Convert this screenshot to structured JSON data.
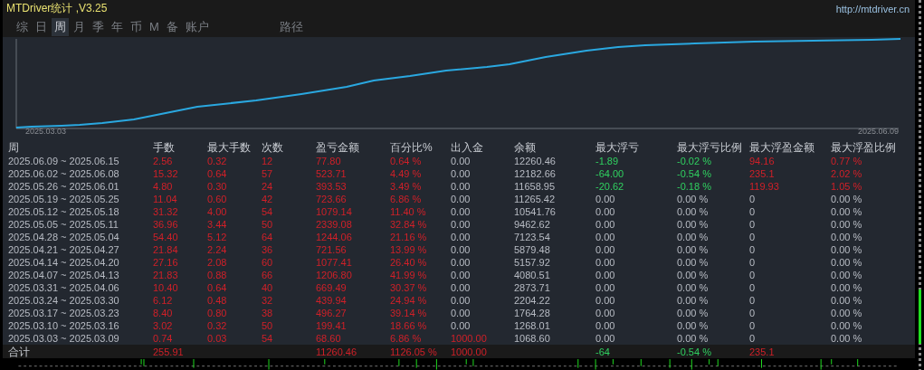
{
  "window": {
    "title": "MTDriver统计 ,V3.25",
    "link": "http://mtdriver.cn"
  },
  "tabs": [
    {
      "label": "综",
      "selected": false
    },
    {
      "label": "日",
      "selected": false
    },
    {
      "label": "周",
      "selected": true
    },
    {
      "label": "月",
      "selected": false
    },
    {
      "label": "季",
      "selected": false
    },
    {
      "label": "年",
      "selected": false
    },
    {
      "label": "币",
      "selected": false
    },
    {
      "label": "M",
      "selected": false
    },
    {
      "label": "备",
      "selected": false
    },
    {
      "label": "账户",
      "selected": false
    }
  ],
  "path_button": "路径",
  "chart": {
    "start_label": "2025.03.03",
    "end_label": "2025.06.09"
  },
  "table": {
    "columns": [
      "周",
      "手数",
      "最大手数",
      "次数",
      "盈亏金额",
      "百分比%",
      "出入金",
      "余额",
      "最大浮亏",
      "最大浮亏比例",
      "最大浮盈金额",
      "最大浮盈比例"
    ],
    "rows": [
      {
        "cells": [
          {
            "text": "2025.06.09 ~ 2025.06.15",
            "kind": "plain"
          },
          {
            "text": "2.56",
            "kind": "gain"
          },
          {
            "text": "0.32",
            "kind": "gain"
          },
          {
            "text": "12",
            "kind": "gain"
          },
          {
            "text": "77.80",
            "kind": "gain"
          },
          {
            "text": "0.64 %",
            "kind": "gain"
          },
          {
            "text": "0.00",
            "kind": "plain"
          },
          {
            "text": "12260.46",
            "kind": "plain"
          },
          {
            "text": "-1.89",
            "kind": "loss"
          },
          {
            "text": "-0.02 %",
            "kind": "loss"
          },
          {
            "text": "94.16",
            "kind": "gain"
          },
          {
            "text": "0.77 %",
            "kind": "gain"
          }
        ]
      },
      {
        "cells": [
          {
            "text": "2025.06.02 ~ 2025.06.08",
            "kind": "plain"
          },
          {
            "text": "15.32",
            "kind": "gain"
          },
          {
            "text": "0.64",
            "kind": "gain"
          },
          {
            "text": "57",
            "kind": "gain"
          },
          {
            "text": "523.71",
            "kind": "gain"
          },
          {
            "text": "4.49 %",
            "kind": "gain"
          },
          {
            "text": "0.00",
            "kind": "plain"
          },
          {
            "text": "12182.66",
            "kind": "plain"
          },
          {
            "text": "-64.00",
            "kind": "loss"
          },
          {
            "text": "-0.54 %",
            "kind": "loss"
          },
          {
            "text": "235.1",
            "kind": "gain"
          },
          {
            "text": "2.02 %",
            "kind": "gain"
          }
        ]
      },
      {
        "cells": [
          {
            "text": "2025.05.26 ~ 2025.06.01",
            "kind": "plain"
          },
          {
            "text": "4.80",
            "kind": "gain"
          },
          {
            "text": "0.30",
            "kind": "gain"
          },
          {
            "text": "24",
            "kind": "gain"
          },
          {
            "text": "393.53",
            "kind": "gain"
          },
          {
            "text": "3.49 %",
            "kind": "gain"
          },
          {
            "text": "0.00",
            "kind": "plain"
          },
          {
            "text": "11658.95",
            "kind": "plain"
          },
          {
            "text": "-20.62",
            "kind": "loss"
          },
          {
            "text": "-0.18 %",
            "kind": "loss"
          },
          {
            "text": "119.93",
            "kind": "gain"
          },
          {
            "text": "1.05 %",
            "kind": "gain"
          }
        ]
      },
      {
        "cells": [
          {
            "text": "2025.05.19 ~ 2025.05.25",
            "kind": "plain"
          },
          {
            "text": "11.04",
            "kind": "gain"
          },
          {
            "text": "0.60",
            "kind": "gain"
          },
          {
            "text": "42",
            "kind": "gain"
          },
          {
            "text": "723.66",
            "kind": "gain"
          },
          {
            "text": "6.86 %",
            "kind": "gain"
          },
          {
            "text": "0.00",
            "kind": "plain"
          },
          {
            "text": "11265.42",
            "kind": "plain"
          },
          {
            "text": "0.00",
            "kind": "plain"
          },
          {
            "text": "0.00 %",
            "kind": "plain"
          },
          {
            "text": "0",
            "kind": "plain"
          },
          {
            "text": "0.00 %",
            "kind": "plain"
          }
        ]
      },
      {
        "cells": [
          {
            "text": "2025.05.12 ~ 2025.05.18",
            "kind": "plain"
          },
          {
            "text": "31.32",
            "kind": "gain"
          },
          {
            "text": "4.00",
            "kind": "gain"
          },
          {
            "text": "54",
            "kind": "gain"
          },
          {
            "text": "1079.14",
            "kind": "gain"
          },
          {
            "text": "11.40 %",
            "kind": "gain"
          },
          {
            "text": "0.00",
            "kind": "plain"
          },
          {
            "text": "10541.76",
            "kind": "plain"
          },
          {
            "text": "0.00",
            "kind": "plain"
          },
          {
            "text": "0.00 %",
            "kind": "plain"
          },
          {
            "text": "0",
            "kind": "plain"
          },
          {
            "text": "0.00 %",
            "kind": "plain"
          }
        ]
      },
      {
        "cells": [
          {
            "text": "2025.05.05 ~ 2025.05.11",
            "kind": "plain"
          },
          {
            "text": "36.96",
            "kind": "gain"
          },
          {
            "text": "3.44",
            "kind": "gain"
          },
          {
            "text": "50",
            "kind": "gain"
          },
          {
            "text": "2339.08",
            "kind": "gain"
          },
          {
            "text": "32.84 %",
            "kind": "gain"
          },
          {
            "text": "0.00",
            "kind": "plain"
          },
          {
            "text": "9462.62",
            "kind": "plain"
          },
          {
            "text": "0.00",
            "kind": "plain"
          },
          {
            "text": "0.00 %",
            "kind": "plain"
          },
          {
            "text": "0",
            "kind": "plain"
          },
          {
            "text": "0.00 %",
            "kind": "plain"
          }
        ]
      },
      {
        "cells": [
          {
            "text": "2025.04.28 ~ 2025.05.04",
            "kind": "plain"
          },
          {
            "text": "54.40",
            "kind": "gain"
          },
          {
            "text": "5.12",
            "kind": "gain"
          },
          {
            "text": "64",
            "kind": "gain"
          },
          {
            "text": "1244.06",
            "kind": "gain"
          },
          {
            "text": "21.16 %",
            "kind": "gain"
          },
          {
            "text": "0.00",
            "kind": "plain"
          },
          {
            "text": "7123.54",
            "kind": "plain"
          },
          {
            "text": "0.00",
            "kind": "plain"
          },
          {
            "text": "0.00 %",
            "kind": "plain"
          },
          {
            "text": "0",
            "kind": "plain"
          },
          {
            "text": "0.00 %",
            "kind": "plain"
          }
        ]
      },
      {
        "cells": [
          {
            "text": "2025.04.21 ~ 2025.04.27",
            "kind": "plain"
          },
          {
            "text": "21.84",
            "kind": "gain"
          },
          {
            "text": "2.24",
            "kind": "gain"
          },
          {
            "text": "36",
            "kind": "gain"
          },
          {
            "text": "721.56",
            "kind": "gain"
          },
          {
            "text": "13.99 %",
            "kind": "gain"
          },
          {
            "text": "0.00",
            "kind": "plain"
          },
          {
            "text": "5879.48",
            "kind": "plain"
          },
          {
            "text": "0.00",
            "kind": "plain"
          },
          {
            "text": "0.00 %",
            "kind": "plain"
          },
          {
            "text": "0",
            "kind": "plain"
          },
          {
            "text": "0.00 %",
            "kind": "plain"
          }
        ]
      },
      {
        "cells": [
          {
            "text": "2025.04.14 ~ 2025.04.20",
            "kind": "plain"
          },
          {
            "text": "27.16",
            "kind": "gain"
          },
          {
            "text": "2.08",
            "kind": "gain"
          },
          {
            "text": "60",
            "kind": "gain"
          },
          {
            "text": "1077.41",
            "kind": "gain"
          },
          {
            "text": "26.40 %",
            "kind": "gain"
          },
          {
            "text": "0.00",
            "kind": "plain"
          },
          {
            "text": "5157.92",
            "kind": "plain"
          },
          {
            "text": "0.00",
            "kind": "plain"
          },
          {
            "text": "0.00 %",
            "kind": "plain"
          },
          {
            "text": "0",
            "kind": "plain"
          },
          {
            "text": "0.00 %",
            "kind": "plain"
          }
        ]
      },
      {
        "cells": [
          {
            "text": "2025.04.07 ~ 2025.04.13",
            "kind": "plain"
          },
          {
            "text": "21.83",
            "kind": "gain"
          },
          {
            "text": "0.88",
            "kind": "gain"
          },
          {
            "text": "66",
            "kind": "gain"
          },
          {
            "text": "1206.80",
            "kind": "gain"
          },
          {
            "text": "41.99 %",
            "kind": "gain"
          },
          {
            "text": "0.00",
            "kind": "plain"
          },
          {
            "text": "4080.51",
            "kind": "plain"
          },
          {
            "text": "0.00",
            "kind": "plain"
          },
          {
            "text": "0.00 %",
            "kind": "plain"
          },
          {
            "text": "0",
            "kind": "plain"
          },
          {
            "text": "0.00 %",
            "kind": "plain"
          }
        ]
      },
      {
        "cells": [
          {
            "text": "2025.03.31 ~ 2025.04.06",
            "kind": "plain"
          },
          {
            "text": "10.40",
            "kind": "gain"
          },
          {
            "text": "0.64",
            "kind": "gain"
          },
          {
            "text": "40",
            "kind": "gain"
          },
          {
            "text": "669.49",
            "kind": "gain"
          },
          {
            "text": "30.37 %",
            "kind": "gain"
          },
          {
            "text": "0.00",
            "kind": "plain"
          },
          {
            "text": "2873.71",
            "kind": "plain"
          },
          {
            "text": "0.00",
            "kind": "plain"
          },
          {
            "text": "0.00 %",
            "kind": "plain"
          },
          {
            "text": "0",
            "kind": "plain"
          },
          {
            "text": "0.00 %",
            "kind": "plain"
          }
        ]
      },
      {
        "cells": [
          {
            "text": "2025.03.24 ~ 2025.03.30",
            "kind": "plain"
          },
          {
            "text": "6.12",
            "kind": "gain"
          },
          {
            "text": "0.48",
            "kind": "gain"
          },
          {
            "text": "32",
            "kind": "gain"
          },
          {
            "text": "439.94",
            "kind": "gain"
          },
          {
            "text": "24.94 %",
            "kind": "gain"
          },
          {
            "text": "0.00",
            "kind": "plain"
          },
          {
            "text": "2204.22",
            "kind": "plain"
          },
          {
            "text": "0.00",
            "kind": "plain"
          },
          {
            "text": "0.00 %",
            "kind": "plain"
          },
          {
            "text": "0",
            "kind": "plain"
          },
          {
            "text": "0.00 %",
            "kind": "plain"
          }
        ]
      },
      {
        "cells": [
          {
            "text": "2025.03.17 ~ 2025.03.23",
            "kind": "plain"
          },
          {
            "text": "8.40",
            "kind": "gain"
          },
          {
            "text": "0.80",
            "kind": "gain"
          },
          {
            "text": "38",
            "kind": "gain"
          },
          {
            "text": "496.27",
            "kind": "gain"
          },
          {
            "text": "39.14 %",
            "kind": "gain"
          },
          {
            "text": "0.00",
            "kind": "plain"
          },
          {
            "text": "1764.28",
            "kind": "plain"
          },
          {
            "text": "0.00",
            "kind": "plain"
          },
          {
            "text": "0.00 %",
            "kind": "plain"
          },
          {
            "text": "0",
            "kind": "plain"
          },
          {
            "text": "0.00 %",
            "kind": "plain"
          }
        ]
      },
      {
        "cells": [
          {
            "text": "2025.03.10 ~ 2025.03.16",
            "kind": "plain"
          },
          {
            "text": "3.02",
            "kind": "gain"
          },
          {
            "text": "0.32",
            "kind": "gain"
          },
          {
            "text": "50",
            "kind": "gain"
          },
          {
            "text": "199.41",
            "kind": "gain"
          },
          {
            "text": "18.66 %",
            "kind": "gain"
          },
          {
            "text": "0.00",
            "kind": "plain"
          },
          {
            "text": "1268.01",
            "kind": "plain"
          },
          {
            "text": "0.00",
            "kind": "plain"
          },
          {
            "text": "0.00 %",
            "kind": "plain"
          },
          {
            "text": "0",
            "kind": "plain"
          },
          {
            "text": "0.00 %",
            "kind": "plain"
          }
        ]
      },
      {
        "cells": [
          {
            "text": "2025.03.03 ~ 2025.03.09",
            "kind": "plain"
          },
          {
            "text": "0.74",
            "kind": "gain"
          },
          {
            "text": "0.03",
            "kind": "gain"
          },
          {
            "text": "54",
            "kind": "gain"
          },
          {
            "text": "68.60",
            "kind": "gain"
          },
          {
            "text": "6.86 %",
            "kind": "gain"
          },
          {
            "text": "1000.00",
            "kind": "gain"
          },
          {
            "text": "1068.60",
            "kind": "plain"
          },
          {
            "text": "0.00",
            "kind": "plain"
          },
          {
            "text": "0.00 %",
            "kind": "plain"
          },
          {
            "text": "0",
            "kind": "plain"
          },
          {
            "text": "0.00 %",
            "kind": "plain"
          }
        ]
      }
    ],
    "total": {
      "label": "合计",
      "lots": {
        "text": "255.91",
        "kind": "gain"
      },
      "profit": {
        "text": "11260.46",
        "kind": "gain"
      },
      "percent": {
        "text": "1126.05 %",
        "kind": "gain"
      },
      "deposit": {
        "text": "1000.00",
        "kind": "gain"
      },
      "max_loss": {
        "text": "-64",
        "kind": "loss"
      },
      "max_loss_ratio": {
        "text": "-0.54 %",
        "kind": "loss"
      },
      "max_profit": {
        "text": "235.1",
        "kind": "gain"
      }
    }
  }
}
